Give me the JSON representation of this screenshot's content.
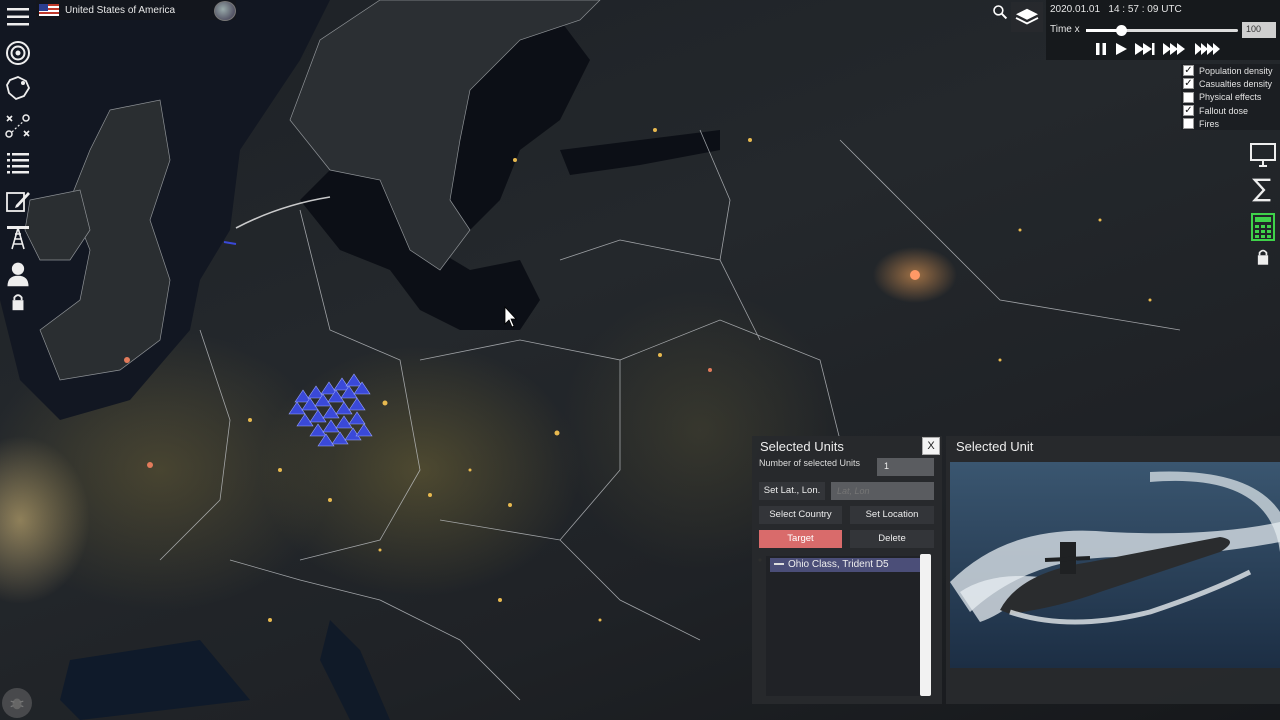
{
  "country": {
    "name": "United States of America",
    "flag_icon": "us-flag-icon"
  },
  "left_toolbar": [
    {
      "name": "menu-icon"
    },
    {
      "name": "target-icon"
    },
    {
      "name": "map-region-icon"
    },
    {
      "name": "tactics-icon"
    },
    {
      "name": "list-icon"
    },
    {
      "name": "edit-icon"
    },
    {
      "name": "radar-tower-icon"
    },
    {
      "name": "user-icon"
    },
    {
      "name": "lock-icon"
    }
  ],
  "time_panel": {
    "datetime": "2020.01.01   14 : 57 : 09 UTC",
    "time_multiplier_label": "Time x",
    "speed_value": "100",
    "slider_level": 0.23
  },
  "layers": [
    {
      "label": "Population density",
      "checked": true
    },
    {
      "label": "Casualties density",
      "checked": true
    },
    {
      "label": "Physical effects",
      "checked": false
    },
    {
      "label": "Fallout dose",
      "checked": true
    },
    {
      "label": "Fires",
      "checked": false
    }
  ],
  "right_toolbar": [
    {
      "name": "monitor-icon"
    },
    {
      "name": "sigma-icon"
    },
    {
      "name": "calculator-icon",
      "color": "#3fd24a"
    },
    {
      "name": "lock-icon"
    }
  ],
  "selected_units": {
    "title": "Selected Units",
    "close_label": "X",
    "count_label": "Number of selected Units",
    "count_value": "1",
    "set_latlon_label": "Set Lat., Lon.",
    "latlon_placeholder": "Lat, Lon",
    "select_country_label": "Select Country",
    "set_location_label": "Set Location",
    "target_label": "Target",
    "delete_label": "Delete",
    "units": [
      {
        "label": "Ohio Class, Trident D5"
      }
    ]
  },
  "selected_unit": {
    "title": "Selected Unit"
  },
  "colors": {
    "target_button": "#d96b6b",
    "unit_marker": "#3a49d8",
    "selected_row": "#4b4e78"
  }
}
